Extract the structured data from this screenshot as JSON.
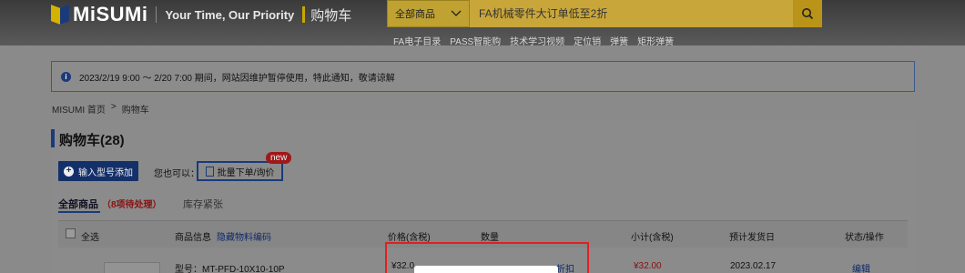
{
  "header": {
    "logo": "MiSUMi",
    "slogan": "Your Time, Our Priority",
    "page_label": "购物车",
    "search": {
      "category": "全部商品",
      "placeholder": "FA机械零件大订单低至2折"
    },
    "quick_links": [
      "FA电子目录",
      "PASS智能购",
      "技术学习视频",
      "定位销",
      "弹簧",
      "矩形弹簧"
    ]
  },
  "notice": {
    "text": "2023/2/19 9:00 ～ 2/20 7:00 期间，网站因维护暂停使用，特此通知，敬请谅解"
  },
  "breadcrumb": [
    "MISUMI 首页",
    ">",
    "购物车"
  ],
  "cart": {
    "title": "购物车(28)",
    "add_button": "输入型号添加",
    "also_label": "您也可以：",
    "bulk_button": "批量下单/询价",
    "new_badge": "new",
    "tabs": {
      "all": "全部商品",
      "pending": "（8项待处理）",
      "stock": "库存紧张"
    },
    "columns": {
      "select_all": "全选",
      "info": "商品信息",
      "hide_code": "隐藏物料编码",
      "price": "价格(含税)",
      "qty": "数量",
      "subtotal": "小计(含税)",
      "ship": "预计发货日",
      "status": "状态/操作"
    },
    "rows": [
      {
        "model": "型号：MT-PFD-10X10-10P",
        "price": "¥32.0",
        "discount": "折扣",
        "subtotal": "¥32.00",
        "ship_date": "2023.02.17",
        "action": "编辑"
      }
    ]
  },
  "colors": {
    "brand_navy": "#1a3a7a",
    "accent_gold": "#c9a63a",
    "alert_red": "#e02020"
  }
}
